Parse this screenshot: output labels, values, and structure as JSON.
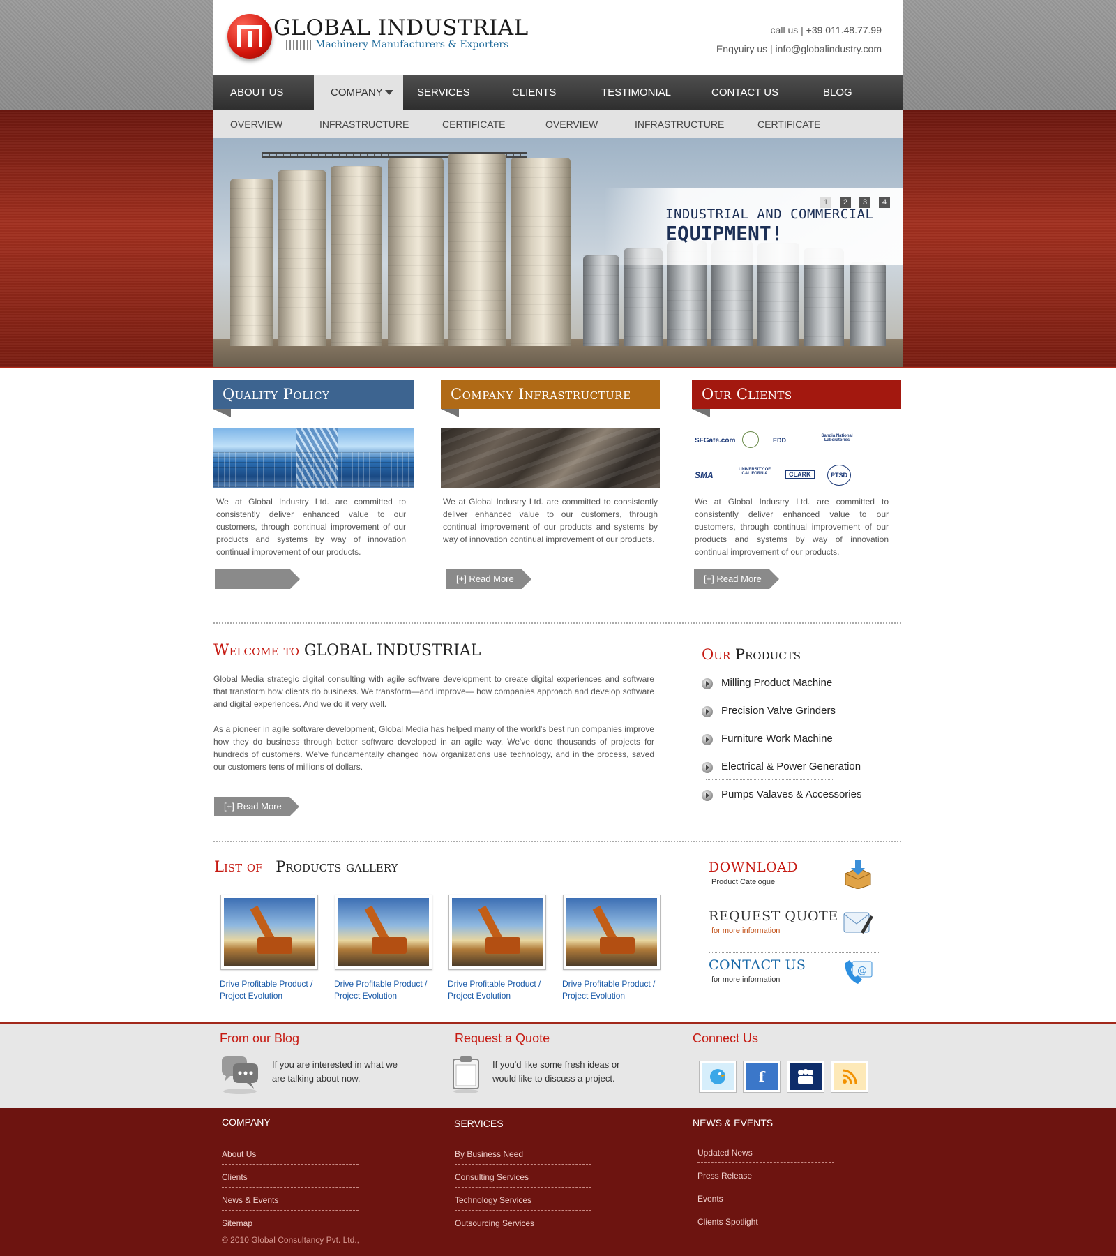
{
  "header": {
    "logo_title": "GLOBAL INDUSTRIAL",
    "logo_subtitle": "Machinery Manufacturers & Exporters",
    "call": "call us | +39 011.48.77.99",
    "enquiry": "Enqyuiry us | info@globalindustry.com"
  },
  "nav": {
    "items": [
      "ABOUT US",
      "COMPANY",
      "SERVICES",
      "CLIENTS",
      "TESTIMONIAL",
      "CONTACT US",
      "BLOG"
    ],
    "active_index": 1
  },
  "subnav": {
    "items": [
      "OVERVIEW",
      "INFRASTRUCTURE",
      "CERTIFICATE",
      "OVERVIEW",
      "INFRASTRUCTURE",
      "CERTIFICATE"
    ]
  },
  "hero": {
    "caption_line1": "INDUSTRIAL AND COMMERCIAL",
    "caption_line2": "EQUIPMENT!",
    "pager": [
      "1",
      "2",
      "3",
      "4"
    ],
    "active_page": 1
  },
  "features": [
    {
      "title": "Quality Policy",
      "color": "#3d6490",
      "text": "We at Global Industry Ltd. are committed to consistently deliver enhanced value to our customers, through continual improvement of our products and systems by way of innovation continual improvement of our products.",
      "button": ""
    },
    {
      "title": "Company Infrastructure",
      "color": "#b06a16",
      "text": "We at Global Industry Ltd. are committed to consistently deliver enhanced value to our customers, through continual improvement of our products and systems by way of innovation continual improvement of our products.",
      "button": "[+] Read More"
    },
    {
      "title": "Our Clients",
      "color": "#a3180f",
      "text": "We at Global Industry Ltd. are committed to consistently deliver enhanced value to our customers, through continual improvement of our products and systems by way of innovation continual improvement of our products.",
      "button": "[+] Read More"
    }
  ],
  "client_logos": [
    "SFGate.com",
    "EDD",
    "Sandia National Laboratories",
    "SMA",
    "UNIVERSITY OF CALIFORNIA",
    "CLARK",
    "PTSD"
  ],
  "welcome": {
    "title_red": "Welcome to",
    "title_dark": "GLOBAL INDUSTRIAL",
    "p1": "Global Media strategic digital consulting with agile software development to create digital experiences and software that transform how clients do business. We transform—and improve— how companies approach and develop software and digital experiences. And we do it very well.",
    "p2": "As a pioneer in agile software development, Global Media has helped many of the world's best run companies improve how they do business through better software developed in an agile way. We've done thousands of projects for hundreds of customers. We've fundamentally changed how organizations use technology, and in the process, saved our customers tens of millions of dollars.",
    "button": "[+] Read More"
  },
  "products": {
    "title_red": "Our",
    "title_dark": "Products",
    "items": [
      "Milling Product Machine",
      "Precision Valve Grinders",
      "Furniture Work Machine",
      "Electrical & Power Generation",
      "Pumps Valaves & Accessories"
    ]
  },
  "gallery": {
    "title_red": "List of",
    "title_dark": "Products gallery",
    "items": [
      {
        "line1": "Drive Profitable Product /",
        "line2": "Project Evolution"
      },
      {
        "line1": "Drive Profitable Product /",
        "line2": "Project Evolution"
      },
      {
        "line1": "Drive Profitable Product /",
        "line2": "Project Evolution"
      },
      {
        "line1": "Drive Profitable Product /",
        "line2": "Project Evolution"
      }
    ]
  },
  "side": {
    "download_title": "DOWNLOAD",
    "download_sub": "Product Catelogue",
    "quote_title": "REQUEST QUOTE",
    "quote_sub": "for more information",
    "contact_title": "CONTACT US",
    "contact_sub": "for more information"
  },
  "footer_grey": {
    "blog_title": "From our Blog",
    "blog_text": "If you are interested in what we are talking about now.",
    "quote_title": "Request a Quote",
    "quote_text": "If you'd like some fresh ideas or would like to discuss a project.",
    "connect_title": "Connect Us",
    "social": [
      "twitter-icon",
      "facebook-icon",
      "myspace-icon",
      "rss-icon"
    ]
  },
  "footer_red": {
    "company_title": "COMPANY",
    "company_items": [
      "About Us",
      "Clients",
      "News & Events",
      "Sitemap"
    ],
    "services_title": "SERVICES",
    "services_items": [
      "By Business Need",
      "Consulting Services",
      "Technology Services",
      "Outsourcing Services"
    ],
    "news_title": "NEWS & EVENTS",
    "news_items": [
      "Updated News",
      "Press Release",
      "Events",
      "Clients Spotlight"
    ],
    "copyright": "© 2010 Global Consultancy Pvt. Ltd.,"
  }
}
